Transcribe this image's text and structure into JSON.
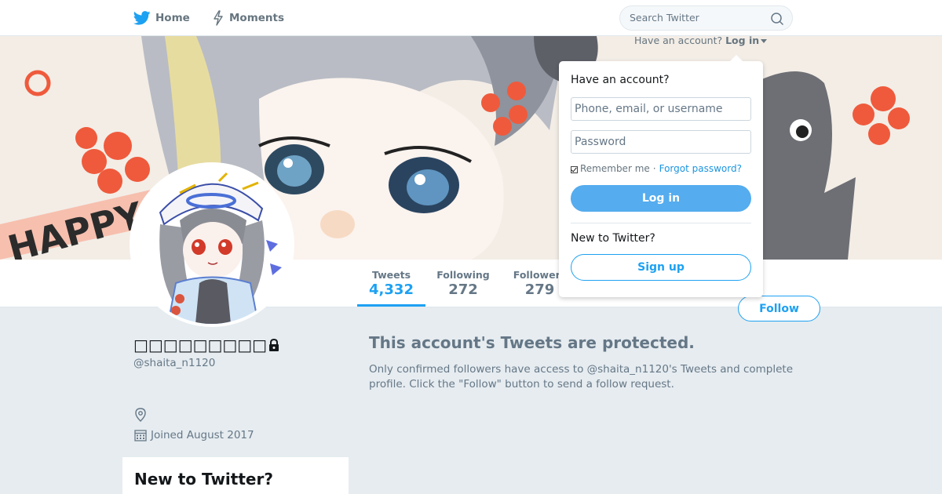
{
  "nav": {
    "home_label": "Home",
    "moments_label": "Moments",
    "search_placeholder": "Search Twitter",
    "login_hint": "Have an account?",
    "login_link": "Log in"
  },
  "colors": {
    "accent": "#1da1f2",
    "background": "#e6ecf0",
    "muted_text": "#657786"
  },
  "profile": {
    "display_name": "□□□□□□□□□",
    "handle": "@shaita_n1120",
    "joined": "Joined August 2017",
    "protected": true
  },
  "stats": {
    "tweets": {
      "label": "Tweets",
      "value": "4,332"
    },
    "following": {
      "label": "Following",
      "value": "272"
    },
    "followers": {
      "label": "Followers",
      "value": "279"
    }
  },
  "actions": {
    "follow_label": "Follow"
  },
  "main": {
    "protected_title": "This account's Tweets are protected.",
    "protected_body": "Only confirmed followers have access to @shaita_n1120's Tweets and complete profile. Click the \"Follow\" button to send a follow request."
  },
  "sidebar": {
    "new_title": "New to Twitter?"
  },
  "login_dropdown": {
    "heading": "Have an account?",
    "username_placeholder": "Phone, email, or username",
    "password_placeholder": "Password",
    "remember_label": "Remember me",
    "separator": "·",
    "forgot_label": "Forgot password?",
    "login_button": "Log in",
    "new_heading": "New to Twitter?",
    "signup_button": "Sign up"
  },
  "banner": {
    "text": "HAPPY"
  },
  "icons": {
    "home": "twitter-bird-icon",
    "moments": "lightning-icon",
    "search": "search-icon",
    "location": "location-pin-icon",
    "calendar": "calendar-icon",
    "lock": "lock-icon"
  }
}
